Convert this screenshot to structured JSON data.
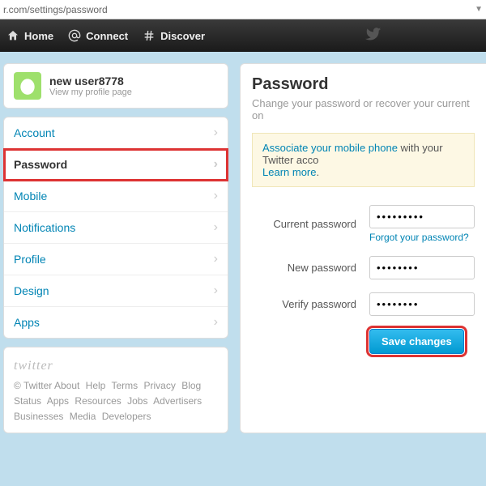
{
  "addressbar": {
    "url": "r.com/settings/password"
  },
  "topnav": {
    "home": "Home",
    "connect": "Connect",
    "discover": "Discover"
  },
  "profile": {
    "name": "new user8778",
    "view_link": "View my profile page"
  },
  "sidebar": {
    "items": [
      {
        "label": "Account"
      },
      {
        "label": "Password"
      },
      {
        "label": "Mobile"
      },
      {
        "label": "Notifications"
      },
      {
        "label": "Profile"
      },
      {
        "label": "Design"
      },
      {
        "label": "Apps"
      }
    ]
  },
  "footer": {
    "logo": "twitter",
    "copyright": "© Twitter",
    "links": [
      "About",
      "Help",
      "Terms",
      "Privacy",
      "Blog",
      "Status",
      "Apps",
      "Resources",
      "Jobs",
      "Advertisers",
      "Businesses",
      "Media",
      "Developers"
    ]
  },
  "main": {
    "title": "Password",
    "subtitle": "Change your password or recover your current on",
    "alert_link1": "Associate your mobile phone",
    "alert_text1": " with your Twitter acco",
    "alert_link2": "Learn more",
    "alert_dot": ".",
    "current_label": "Current password",
    "current_value": "•••••••••",
    "forgot": "Forgot your password?",
    "new_label": "New password",
    "new_value": "••••••••",
    "verify_label": "Verify password",
    "verify_value": "••••••••",
    "save": "Save changes"
  }
}
